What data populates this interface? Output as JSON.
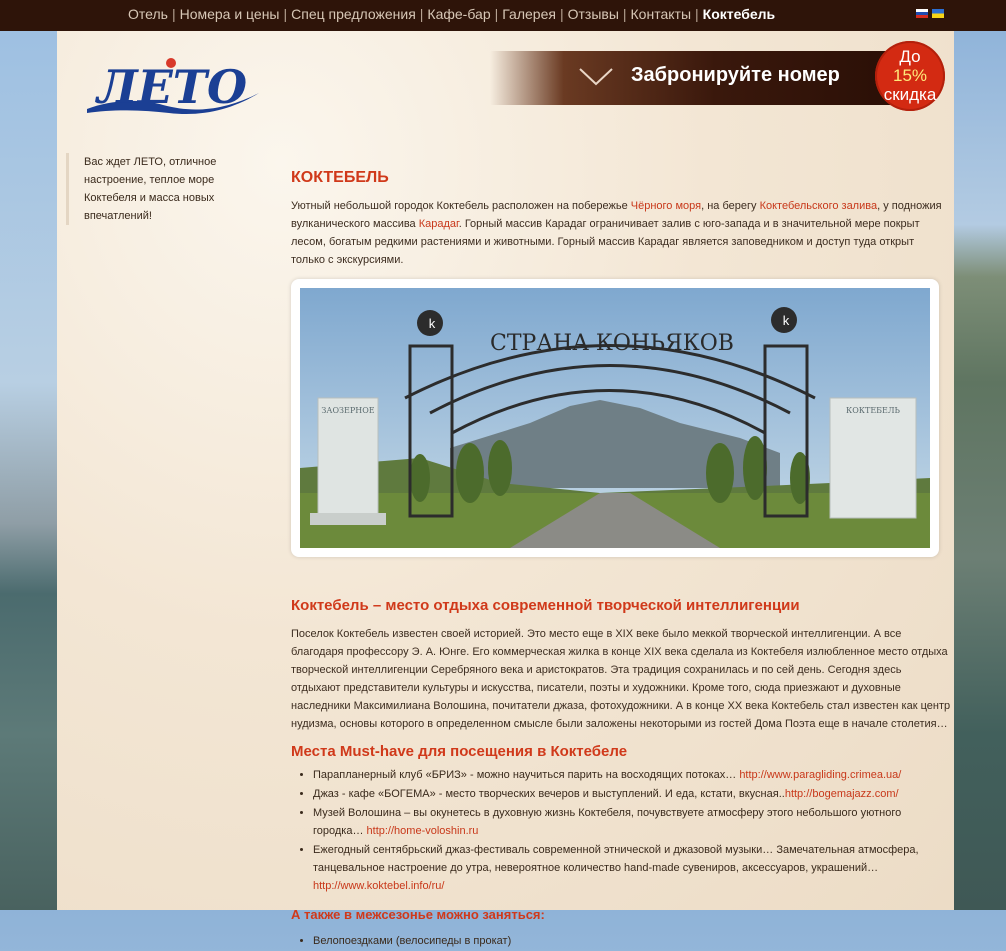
{
  "nav": {
    "items": [
      "Отель",
      "Номера и цены",
      "Спец предложения",
      "Кафе-бар",
      "Галерея",
      "Отзывы",
      "Контакты",
      "Коктебель"
    ],
    "active_index": 7,
    "flags": [
      "flag-ru",
      "flag-ua"
    ]
  },
  "brand": {
    "logo_text": "ЛЕТО"
  },
  "booking": {
    "label": "Забронируйте номер"
  },
  "discount": {
    "line1": "До",
    "percent": "15%",
    "line3": "скидка"
  },
  "sidebar": {
    "note": "Вас ждет ЛЕТО, отличное настроение, теплое море Коктебеля и масса новых впечатлений!"
  },
  "article": {
    "title": "КОКТЕБЕЛЬ",
    "intro": {
      "p1": "Уютный небольшой городок Коктебель расположен на побережье ",
      "link1": "Чёрного моря",
      "p2": ", на берегу ",
      "link2": "Коктебельского залива",
      "p3": ", у подножия вулканического массива ",
      "link3": "Карадаг",
      "p4": ". Горный массив Карадаг ограничивает залив с юго-запада и в значительной мере покрыт лесом, богатым редкими растениями и животными. Горный массив Карадаг является заповедником и доступ туда открыт только с экскурсиями."
    },
    "photo": {
      "sign_text": "СТРАНА КОНЬЯКОВ",
      "left_pillar": "ЗАОЗЕРНОЕ",
      "right_pillar": "КОКТЕБЕЛЬ"
    },
    "section1_title": "Коктебель – место отдыха современной творческой интеллигенции",
    "section1_text": "Поселок Коктебель известен своей историей. Это место еще в XIX веке было меккой творческой интеллигенции. А все благодаря профессору Э. А. Юнге. Его коммерческая жилка в конце XIX века сделала из Коктебеля излюбленное место отдыха творческой интеллигенции Серебряного века и аристократов. Эта традиция сохранилась и по сей день. Сегодня здесь отдыхают представители культуры и искусства, писатели, поэты и художники. Кроме того, сюда приезжают и духовные наследники Максимилиана Волошина, почитатели джаза, фотохудожники. А в конце XX века Коктебель стал известен как центр нудизма, основы которого в определенном смысле были заложены некоторыми из гостей Дома Поэта еще в начале столетия…",
    "section2_title": "Места Must-have для посещения в Коктебеле",
    "places": [
      {
        "text": "Парапланерный клуб «БРИЗ» - можно научиться парить на восходящих потоках… ",
        "link": "http://www.paragliding.crimea.ua/"
      },
      {
        "text": "Джаз - кафе «БОГЕМА» - место творческих вечеров и выступлений. И еда, кстати, вкусная..",
        "link": "http://bogemajazz.com/"
      },
      {
        "text": "Музей Волошина – вы окунетесь в духовную жизнь Коктебеля, почувствуете атмосферу этого небольшого уютного городка…  ",
        "link": "http://home-voloshin.ru"
      },
      {
        "text": "Ежегодный сентябрьский джаз-фестиваль современной этнической и джазовой музыки…  Замечательная атмосфера, танцевальное настроение до утра, невероятное количество  hand-made сувениров, аксессуаров, украшений…  ",
        "link": "http://www.koktebel.info/ru/"
      }
    ],
    "section3_title": "А также в межсезонье можно заняться:",
    "offseason": [
      "Велопоездками (велосипеды в прокат)"
    ]
  }
}
